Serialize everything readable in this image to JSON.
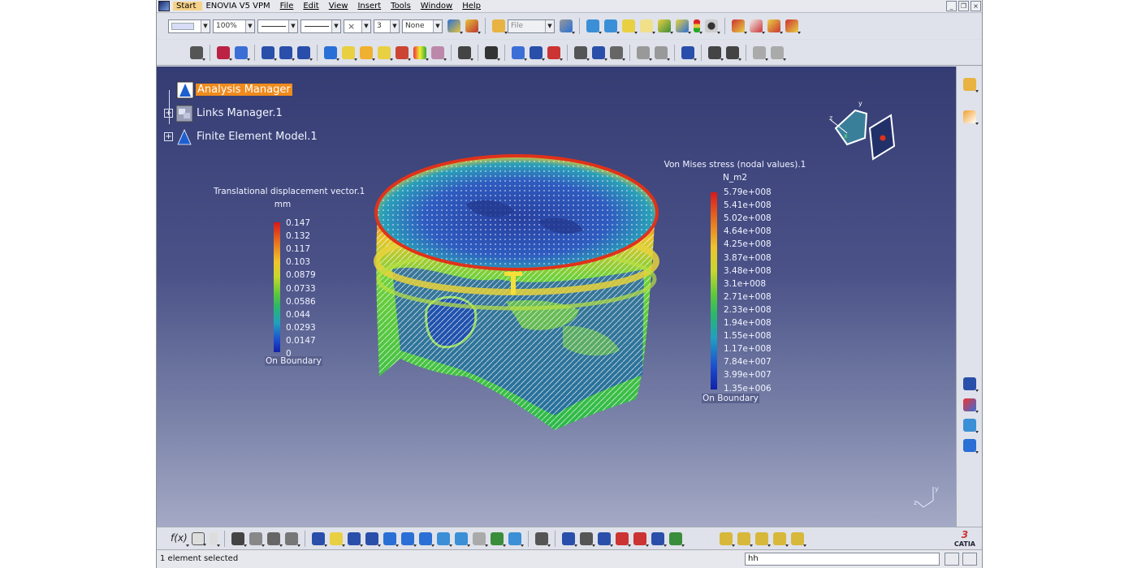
{
  "menubar": {
    "items": [
      "Start",
      "ENOVIA V5 VPM",
      "File",
      "Edit",
      "View",
      "Insert",
      "Tools",
      "Window",
      "Help"
    ]
  },
  "toolbar1": {
    "color_combo": "",
    "zoom_combo": "100%",
    "linetype_combo": "",
    "lineweight_combo": "",
    "point_combo": "",
    "layer_combo": "3",
    "render_combo": "None",
    "filter_combo": "File"
  },
  "tree": {
    "root": "Analysis Manager",
    "children": [
      "Links Manager.1",
      "Finite Element Model.1"
    ]
  },
  "displacement_legend": {
    "title": "Translational displacement vector.1",
    "unit": "mm",
    "values": [
      "0.147",
      "0.132",
      "0.117",
      "0.103",
      "0.0879",
      "0.0733",
      "0.0586",
      "0.044",
      "0.0293",
      "0.0147",
      "0"
    ],
    "footer": "On Boundary"
  },
  "stress_legend": {
    "title": "Von Mises stress (nodal values).1",
    "unit": "N_m2",
    "values": [
      "5.79e+008",
      "5.41e+008",
      "5.02e+008",
      "4.64e+008",
      "4.25e+008",
      "3.87e+008",
      "3.48e+008",
      "3.1e+008",
      "2.71e+008",
      "2.33e+008",
      "1.94e+008",
      "1.55e+008",
      "1.17e+008",
      "7.84e+007",
      "3.99e+007",
      "1.35e+006"
    ],
    "footer": "On Boundary"
  },
  "compass": {
    "x_label": "x",
    "y_label": "y",
    "z_label": "z"
  },
  "statusbar": {
    "message": "1 element selected",
    "command": "hh"
  },
  "brand": "CATIA",
  "colors": {
    "viewport_top": "#343c73",
    "viewport_bottom": "#a4aac5",
    "tree_highlight": "#f08b1c"
  }
}
